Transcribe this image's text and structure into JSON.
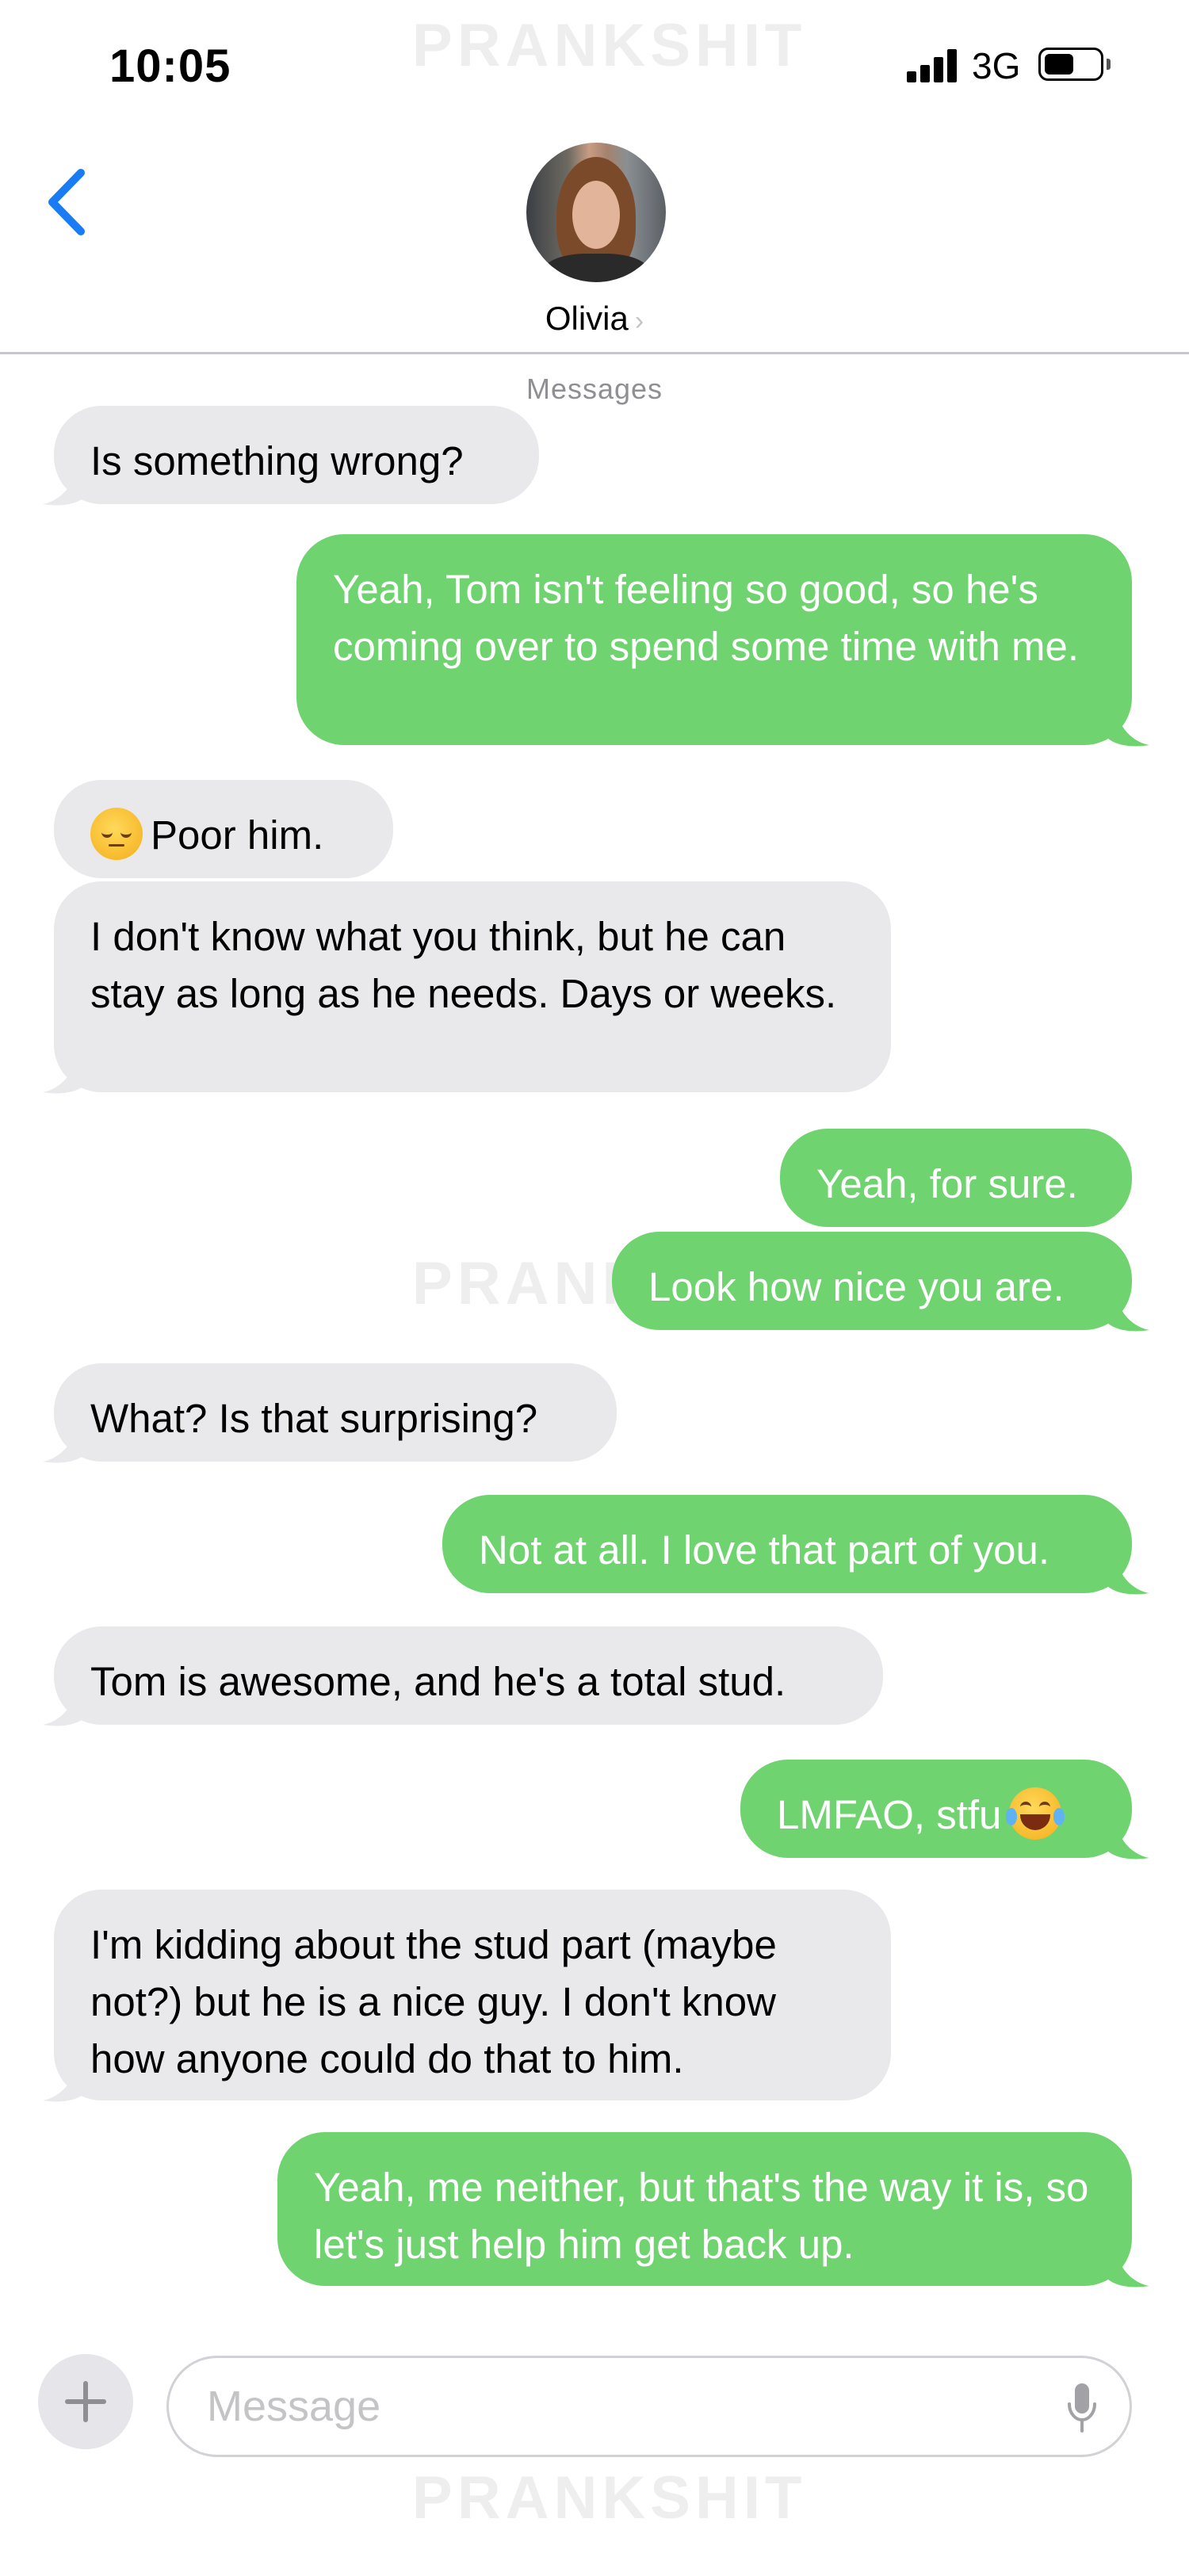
{
  "status_bar": {
    "time": "10:05",
    "network": "3G",
    "watermark": "PRANKSHIT"
  },
  "header": {
    "contact_name": "Olivia",
    "chevron": "›",
    "back_icon": "chevron-left-icon",
    "service_label": "Messages"
  },
  "messages": [
    {
      "side": "received",
      "text": "Is something wrong?"
    },
    {
      "side": "sent",
      "text": "Yeah, Tom isn't feeling so good, so he's coming over to spend some time with me."
    },
    {
      "side": "received",
      "text": "Poor him.",
      "emoji": "pensive-face-emoji"
    },
    {
      "side": "received",
      "text": "I don't know what you think, but he can stay as long as he needs. Days or weeks."
    },
    {
      "side": "sent",
      "text": "Yeah, for sure."
    },
    {
      "side": "sent",
      "text": "Look how nice you are."
    },
    {
      "side": "received",
      "text": "What? Is that surprising?"
    },
    {
      "side": "sent",
      "text": "Not at all. I love that part of you."
    },
    {
      "side": "received",
      "text": "Tom is awesome, and he's a total stud."
    },
    {
      "side": "sent",
      "text": "LMFAO, stfu",
      "emoji": "tears-of-joy-emoji"
    },
    {
      "side": "received",
      "text": "I'm kidding about the stud part (maybe not?) but he is a nice guy. I don't know how anyone could do that to him."
    },
    {
      "side": "sent",
      "text": "Yeah, me neither, but that's the way it is, so let's just help him get back up."
    }
  ],
  "composer": {
    "placeholder": "Message",
    "add_icon": "plus-icon",
    "mic_icon": "microphone-icon"
  },
  "colors": {
    "sent_bubble": "#6fd36f",
    "received_bubble": "#e9e9eb",
    "accent": "#1a7cf5"
  }
}
